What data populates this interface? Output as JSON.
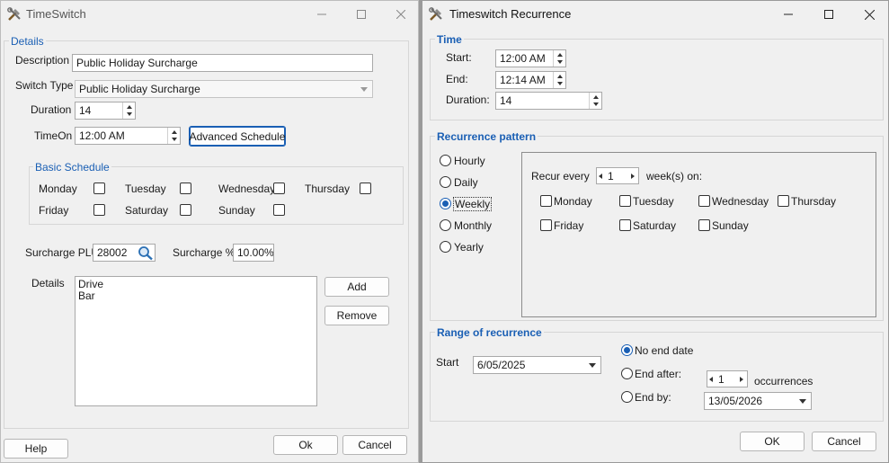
{
  "left_window": {
    "title": "TimeSwitch",
    "details_group": "Details",
    "description_label": "Description",
    "description_value": "Public Holiday Surcharge",
    "switch_type_label": "Switch Type",
    "switch_type_value": "Public Holiday Surcharge",
    "duration_label": "Duration",
    "duration_value": "14",
    "timeon_label": "TimeOn",
    "timeon_value": "12:00 AM",
    "advanced_schedule_label": "Advanced Schedule",
    "basic_schedule_group": "Basic Schedule",
    "days": [
      "Monday",
      "Tuesday",
      "Wednesday",
      "Thursday",
      "Friday",
      "Saturday",
      "Sunday"
    ],
    "surcharge_plu_label": "Surcharge PLU",
    "surcharge_plu_value": "28002",
    "surcharge_pct_label": "Surcharge %",
    "surcharge_pct_value": "10.00%",
    "details_list_label": "Details",
    "details_items": [
      "Drive",
      "Bar"
    ],
    "add_label": "Add",
    "remove_label": "Remove",
    "help_label": "Help",
    "ok_label": "Ok",
    "cancel_label": "Cancel"
  },
  "right_window": {
    "title": "Timeswitch Recurrence",
    "time_group": "Time",
    "start_label": "Start:",
    "start_value": "12:00 AM",
    "end_label": "End:",
    "end_value": "12:14 AM",
    "duration_label": "Duration:",
    "duration_value": "14",
    "pattern_group": "Recurrence pattern",
    "patterns": [
      "Hourly",
      "Daily",
      "Weekly",
      "Monthly",
      "Yearly"
    ],
    "selected_pattern": "Weekly",
    "recur_every_label": "Recur every",
    "recur_every_value": "1",
    "weeks_on_label": "week(s) on:",
    "days": [
      "Monday",
      "Tuesday",
      "Wednesday",
      "Thursday",
      "Friday",
      "Saturday",
      "Sunday"
    ],
    "range_group": "Range of recurrence",
    "range_start_label": "Start",
    "range_start_value": "6/05/2025",
    "no_end_label": "No end date",
    "end_after_label": "End after:",
    "end_after_value": "1",
    "occurrences_label": "occurrences",
    "end_by_label": "End by:",
    "end_by_value": "13/05/2026",
    "ok_label": "OK",
    "cancel_label": "Cancel"
  },
  "colors": {
    "accent": "#1a5fb4",
    "window_bg": "#f0f0f0"
  }
}
